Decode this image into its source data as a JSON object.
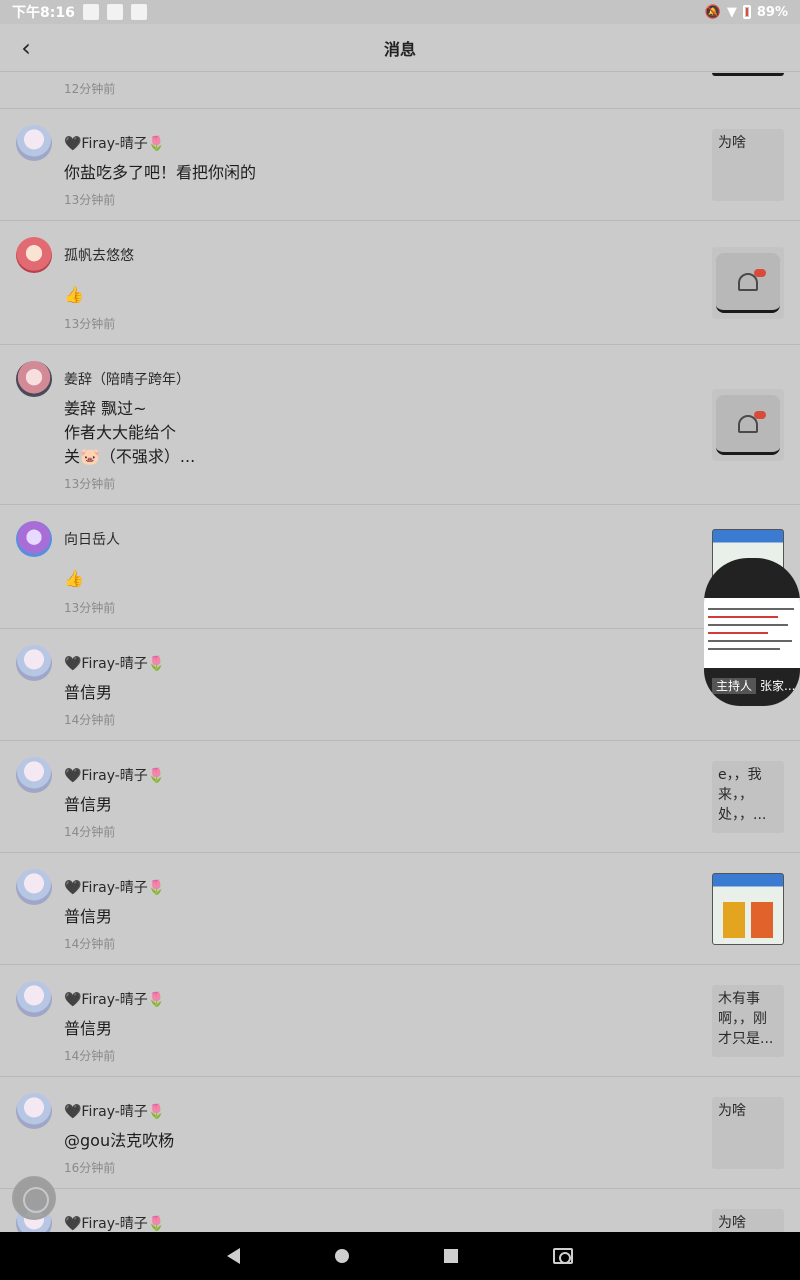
{
  "status": {
    "time": "下午8:16",
    "battery": "89%"
  },
  "header": {
    "title": "消息",
    "back_icon": "chevron-left-icon"
  },
  "top_partial": {
    "time": "12分钟前"
  },
  "messages": [
    {
      "name": "🖤Firay-晴子🌷",
      "body": "你盐吃多了吧！看把你闲的",
      "time": "13分钟前",
      "thumb": "为啥"
    },
    {
      "name": "孤帆去悠悠",
      "body": "👍",
      "time": "13分钟前",
      "thumb": ""
    },
    {
      "name": "姜辞（陪晴子跨年）",
      "body_lines": [
        "姜辞 飘过~",
        "作者大大能给个",
        "关🐷（不强求）..."
      ],
      "time": "13分钟前",
      "thumb": ""
    },
    {
      "name": "向日岳人",
      "body": "👍",
      "time": "13分钟前",
      "thumb": ""
    },
    {
      "name": "🖤Firay-晴子🌷",
      "body": "普信男",
      "time": "14分钟前",
      "thumb": ""
    },
    {
      "name": "🖤Firay-晴子🌷",
      "body": "普信男",
      "time": "14分钟前",
      "thumb": "e，，我来，，处，，..."
    },
    {
      "name": "🖤Firay-晴子🌷",
      "body": "普信男",
      "time": "14分钟前",
      "thumb": ""
    },
    {
      "name": "🖤Firay-晴子🌷",
      "body": "普信男",
      "time": "14分钟前",
      "thumb": "木有事啊，，刚才只是..."
    },
    {
      "name": "🖤Firay-晴子🌷",
      "body": "@gou法克吹杨",
      "time": "16分钟前",
      "thumb": "为啥"
    },
    {
      "name": "🖤Firay-晴子🌷",
      "body": "",
      "time": "",
      "thumb": "为啥"
    }
  ],
  "float_card": {
    "tag": "主持人",
    "caption": "张家..."
  },
  "colors": {
    "like": "#e0541e",
    "background": "#cbcbcb"
  }
}
